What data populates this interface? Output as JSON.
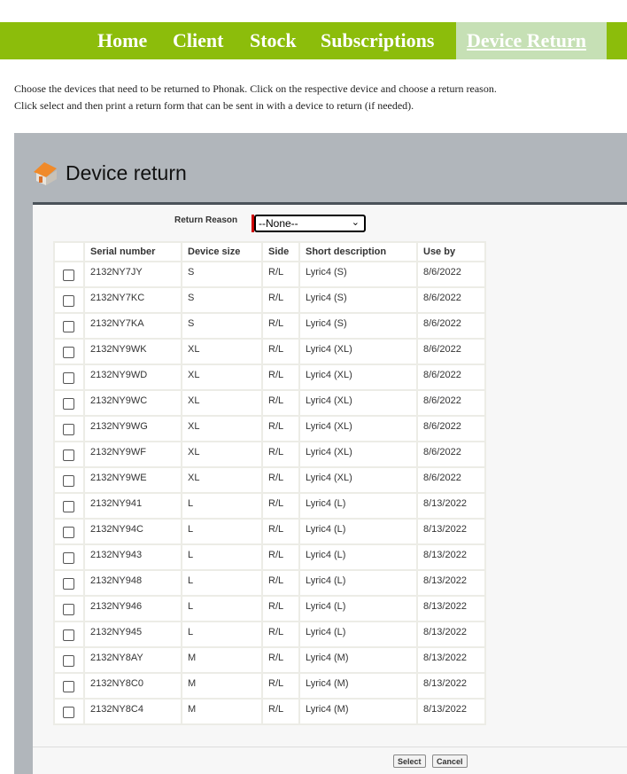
{
  "nav": {
    "items": [
      "Home",
      "Client",
      "Stock",
      "Subscriptions",
      "Device Return"
    ],
    "active": "Device Return"
  },
  "intro": {
    "line1": "Choose the devices that need to be returned to Phonak. Click on the respective device and choose a return reason.",
    "line2": "Click select and then print a return form that can be sent in with a device to return (if needed)."
  },
  "panel": {
    "title": "Device return",
    "icon": "house-icon"
  },
  "form": {
    "return_reason_label": "Return Reason",
    "return_reason_value": "--None--"
  },
  "table": {
    "headers": [
      "",
      "Serial number",
      "Device size",
      "Side",
      "Short description",
      "Use by"
    ],
    "rows": [
      [
        "2132NY7JY",
        "S",
        "R/L",
        "Lyric4 (S)",
        "8/6/2022"
      ],
      [
        "2132NY7KC",
        "S",
        "R/L",
        "Lyric4 (S)",
        "8/6/2022"
      ],
      [
        "2132NY7KA",
        "S",
        "R/L",
        "Lyric4 (S)",
        "8/6/2022"
      ],
      [
        "2132NY9WK",
        "XL",
        "R/L",
        "Lyric4 (XL)",
        "8/6/2022"
      ],
      [
        "2132NY9WD",
        "XL",
        "R/L",
        "Lyric4 (XL)",
        "8/6/2022"
      ],
      [
        "2132NY9WC",
        "XL",
        "R/L",
        "Lyric4 (XL)",
        "8/6/2022"
      ],
      [
        "2132NY9WG",
        "XL",
        "R/L",
        "Lyric4 (XL)",
        "8/6/2022"
      ],
      [
        "2132NY9WF",
        "XL",
        "R/L",
        "Lyric4 (XL)",
        "8/6/2022"
      ],
      [
        "2132NY9WE",
        "XL",
        "R/L",
        "Lyric4 (XL)",
        "8/6/2022"
      ],
      [
        "2132NY941",
        "L",
        "R/L",
        "Lyric4 (L)",
        "8/13/2022"
      ],
      [
        "2132NY94C",
        "L",
        "R/L",
        "Lyric4 (L)",
        "8/13/2022"
      ],
      [
        "2132NY943",
        "L",
        "R/L",
        "Lyric4 (L)",
        "8/13/2022"
      ],
      [
        "2132NY948",
        "L",
        "R/L",
        "Lyric4 (L)",
        "8/13/2022"
      ],
      [
        "2132NY946",
        "L",
        "R/L",
        "Lyric4 (L)",
        "8/13/2022"
      ],
      [
        "2132NY945",
        "L",
        "R/L",
        "Lyric4 (L)",
        "8/13/2022"
      ],
      [
        "2132NY8AY",
        "M",
        "R/L",
        "Lyric4 (M)",
        "8/13/2022"
      ],
      [
        "2132NY8C0",
        "M",
        "R/L",
        "Lyric4 (M)",
        "8/13/2022"
      ],
      [
        "2132NY8C4",
        "M",
        "R/L",
        "Lyric4 (M)",
        "8/13/2022"
      ]
    ]
  },
  "buttons": {
    "select": "Select",
    "cancel": "Cancel"
  }
}
